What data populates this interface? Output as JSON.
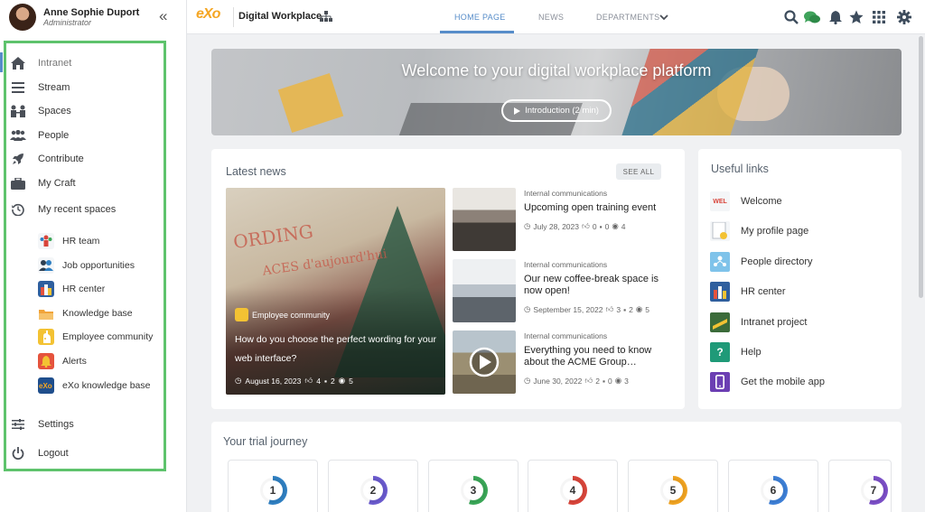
{
  "user": {
    "name": "Anne Sophie Duport",
    "role": "Administrator"
  },
  "sidebar": {
    "collapse_glyph": "«",
    "items": [
      {
        "label": "Intranet",
        "icon": "home-icon"
      },
      {
        "label": "Stream",
        "icon": "stream-icon"
      },
      {
        "label": "Spaces",
        "icon": "spaces-icon"
      },
      {
        "label": "People",
        "icon": "people-icon"
      },
      {
        "label": "Contribute",
        "icon": "rocket-icon"
      },
      {
        "label": "My Craft",
        "icon": "briefcase-icon"
      },
      {
        "label": "My recent spaces",
        "icon": "history-icon"
      }
    ],
    "recent_spaces": [
      {
        "label": "HR team",
        "color": "#f4f6f8"
      },
      {
        "label": "Job opportunities",
        "color": "#f4f6f8"
      },
      {
        "label": "HR center",
        "color": "#2f5f9e"
      },
      {
        "label": "Knowledge base",
        "color": "#f1a43a"
      },
      {
        "label": "Employee community",
        "color": "#f3c233"
      },
      {
        "label": "Alerts",
        "color": "#e5533d"
      },
      {
        "label": "eXo knowledge base",
        "color": "#1f4e8c"
      }
    ],
    "settings_label": "Settings",
    "logout_label": "Logout"
  },
  "topbar": {
    "logo": "eXo",
    "site_name": "Digital Workplace",
    "tabs": [
      {
        "label": "HOME PAGE",
        "active": true
      },
      {
        "label": "NEWS",
        "active": false
      },
      {
        "label": "DEPARTMENTS",
        "active": false
      }
    ],
    "tools": [
      "search-icon",
      "chat-icon",
      "notifications-icon",
      "favorites-icon",
      "apps-grid-icon",
      "settings-icon"
    ]
  },
  "banner": {
    "title": "Welcome to your digital workplace platform",
    "button_label": "Introduction (2 min)"
  },
  "news": {
    "title": "Latest news",
    "see_all": "SEE ALL",
    "featured": {
      "category": "Employee community",
      "title": "How do you choose the perfect wording for your web interface?",
      "date": "August 16, 2023",
      "likes": "4",
      "comments": "2",
      "views": "5",
      "image_text_1": "ORDING",
      "image_text_2": "ACES d'aujourd'hui"
    },
    "items": [
      {
        "category": "Internal communications",
        "title": "Upcoming open training event",
        "date": "July 28, 2023",
        "likes": "0",
        "comments": "0",
        "views": "4"
      },
      {
        "category": "Internal communications",
        "title": "Our new coffee-break space is now open!",
        "date": "September 15, 2022",
        "likes": "3",
        "comments": "2",
        "views": "5"
      },
      {
        "category": "Internal communications",
        "title": "Everything you need to know about the ACME Group…",
        "date": "June 30, 2022",
        "likes": "2",
        "comments": "0",
        "views": "3"
      }
    ]
  },
  "useful_links": {
    "title": "Useful links",
    "items": [
      {
        "label": "Welcome",
        "color": "#f4f6f8",
        "glyph": "W"
      },
      {
        "label": "My profile page",
        "color": "#f4f6f8",
        "glyph": "P"
      },
      {
        "label": "People directory",
        "color": "#7fc3ea",
        "glyph": "▲"
      },
      {
        "label": "HR center",
        "color": "#2f5f9e",
        "glyph": "H"
      },
      {
        "label": "Intranet project",
        "color": "#3b6b3a",
        "glyph": "I"
      },
      {
        "label": "Help",
        "color": "#1f9a78",
        "glyph": "?"
      },
      {
        "label": "Get the mobile app",
        "color": "#6c3fb3",
        "glyph": "▯"
      }
    ]
  },
  "journey": {
    "title": "Your trial journey",
    "steps": [
      {
        "num": "1",
        "color": "#2f7fc1"
      },
      {
        "num": "2",
        "color": "#6a5acd"
      },
      {
        "num": "3",
        "color": "#3aa657"
      },
      {
        "num": "4",
        "color": "#d8453b"
      },
      {
        "num": "5",
        "color": "#f0a321"
      },
      {
        "num": "6",
        "color": "#3d7fd6"
      },
      {
        "num": "7",
        "color": "#7b4fc6"
      }
    ]
  }
}
